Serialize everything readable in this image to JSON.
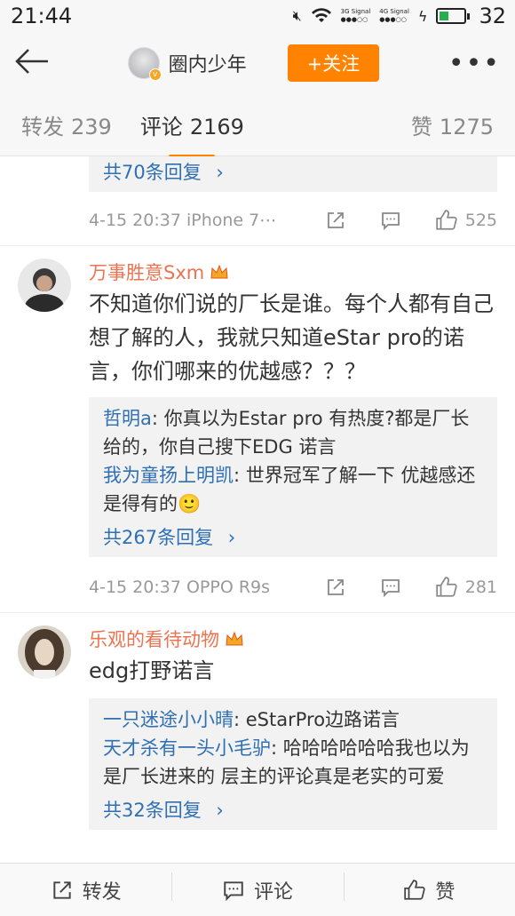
{
  "status": {
    "time": "21:44",
    "sig1": "3G Signal",
    "sig2": "4G Signal",
    "battery": "32"
  },
  "header": {
    "username": "圈内少年",
    "follow": "+关注",
    "more": "•••"
  },
  "tabs": {
    "repost_label": "转发",
    "repost_count": "239",
    "comment_label": "评论",
    "comment_count": "2169",
    "like_label": "赞",
    "like_count": "1275"
  },
  "comments": [
    {
      "reply_more": "共70条回复",
      "meta": {
        "time": "4-15 20:37 iPhone 7⋯",
        "likes": "525"
      }
    },
    {
      "name": "万事胜意Sxm",
      "text": "不知道你们说的厂长是谁。每个人都有自己想了解的人，我就只知道eStar pro的诺言，你们哪来的优越感？？？",
      "replies": [
        {
          "name": "哲明a",
          "text": ": 你真以为Estar pro 有热度?都是厂长给的，你自己搜下EDG 诺言"
        },
        {
          "name": "我为童扬上明凯",
          "text": ": 世界冠军了解一下 优越感还是得有的🙂"
        }
      ],
      "reply_more": "共267条回复",
      "meta": {
        "time": "4-15 20:37 OPPO R9s",
        "likes": "281"
      }
    },
    {
      "name": "乐观的看待动物",
      "text": "edg打野诺言",
      "replies": [
        {
          "name": "一只迷途小小晴",
          "text": ": eStarPro边路诺言"
        },
        {
          "name": "天才杀有一头小毛驴",
          "text": ": 哈哈哈哈哈哈我也以为是厂长进来的 层主的评论真是老实的可爱"
        }
      ],
      "reply_more": "共32条回复"
    }
  ],
  "bottom": {
    "repost": "转发",
    "comment": "评论",
    "like": "赞"
  },
  "colors": {
    "accent": "#ff8200",
    "link": "#2f6fb3",
    "name": "#eb7350"
  }
}
